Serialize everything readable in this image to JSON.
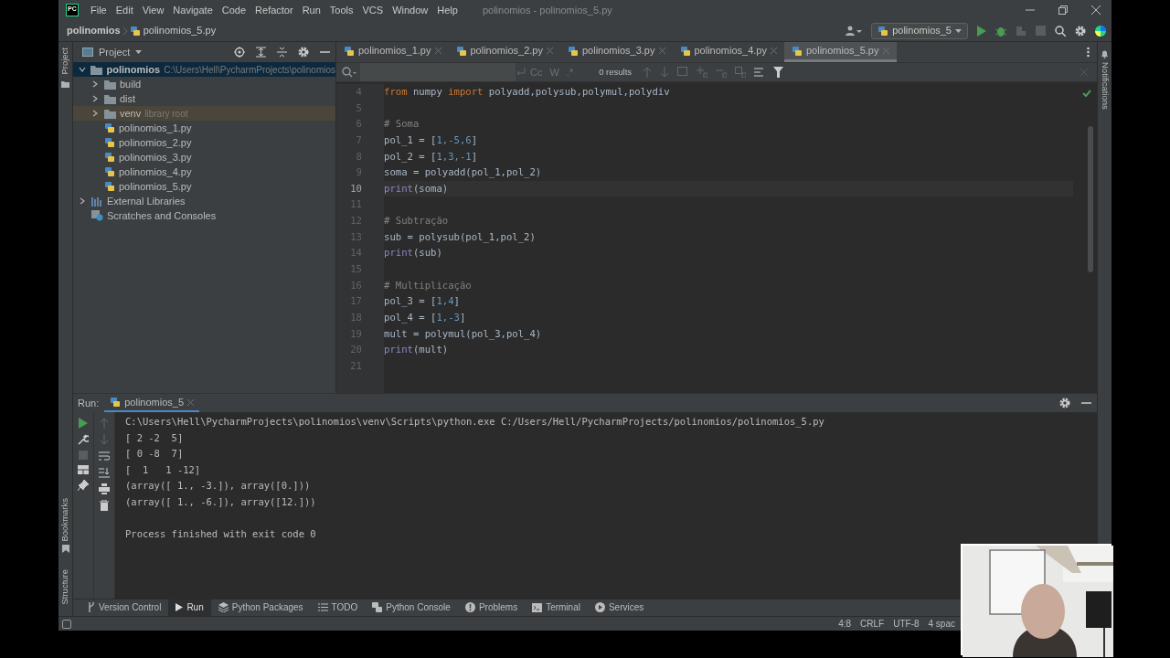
{
  "window": {
    "logo": "PC",
    "menu": [
      "File",
      "Edit",
      "View",
      "Navigate",
      "Code",
      "Refactor",
      "Run",
      "Tools",
      "VCS",
      "Window",
      "Help"
    ],
    "title": "polinomios - polinomios_5.py"
  },
  "breadcrumb": [
    "polinomios",
    "polinomios_5.py"
  ],
  "run_config": "polinomios_5",
  "side_tabs": {
    "left_top": "Project",
    "left_bottom": [
      "Bookmarks",
      "Structure"
    ],
    "right": "Notifications"
  },
  "project_panel": {
    "title": "Project",
    "tree": [
      {
        "label": "polinomios",
        "hint": "C:\\Users\\Hell\\PycharmProjects\\polinomios",
        "kind": "folder",
        "expanded": true,
        "selected": true,
        "hovered": false,
        "children": [
          {
            "label": "build",
            "kind": "folder",
            "expanded": false,
            "selected": false,
            "hovered": false
          },
          {
            "label": "dist",
            "kind": "folder",
            "expanded": false,
            "selected": false,
            "hovered": false
          },
          {
            "label": "venv",
            "hint": "library root",
            "kind": "folder",
            "expanded": false,
            "selected": false,
            "hovered": true
          },
          {
            "label": "polinomios_1.py",
            "kind": "file",
            "selected": false,
            "hovered": false
          },
          {
            "label": "polinomios_2.py",
            "kind": "file",
            "selected": false,
            "hovered": false
          },
          {
            "label": "polinomios_3.py",
            "kind": "file",
            "selected": false,
            "hovered": false
          },
          {
            "label": "polinomios_4.py",
            "kind": "file",
            "selected": false,
            "hovered": false
          },
          {
            "label": "polinomios_5.py",
            "kind": "file",
            "selected": false,
            "hovered": false
          }
        ]
      },
      {
        "label": "External Libraries",
        "kind": "libraries",
        "expanded": false,
        "selected": false,
        "hovered": false
      },
      {
        "label": "Scratches and Consoles",
        "kind": "scratches",
        "selected": false,
        "hovered": false
      }
    ]
  },
  "tabs": [
    {
      "label": "polinomios_1.py",
      "selected": false
    },
    {
      "label": "polinomios_2.py",
      "selected": false
    },
    {
      "label": "polinomios_3.py",
      "selected": false
    },
    {
      "label": "polinomios_4.py",
      "selected": false
    },
    {
      "label": "polinomios_5.py",
      "selected": true
    }
  ],
  "find_bar": {
    "options": [
      "Cc",
      "W",
      ".*"
    ],
    "results": "0 results"
  },
  "editor": {
    "lines": [
      {
        "number": "4",
        "current": false,
        "tokens": [
          {
            "text": "from",
            "kind": "keyword"
          },
          {
            "text": " numpy ",
            "kind": "plain"
          },
          {
            "text": "import",
            "kind": "keyword"
          },
          {
            "text": " polyadd,polysub,polymul,polydiv",
            "kind": "plain"
          }
        ]
      },
      {
        "number": "5",
        "current": false
      },
      {
        "number": "6",
        "current": false,
        "tokens": [
          {
            "text": "# Soma",
            "kind": "comment"
          }
        ]
      },
      {
        "number": "7",
        "current": false,
        "tokens": [
          {
            "text": "pol_1 = [",
            "kind": "plain"
          },
          {
            "text": "1,-5,6",
            "kind": "number"
          },
          {
            "text": "]",
            "kind": "plain"
          }
        ]
      },
      {
        "number": "8",
        "current": false,
        "tokens": [
          {
            "text": "pol_2 = [",
            "kind": "plain"
          },
          {
            "text": "1,3,-1",
            "kind": "number"
          },
          {
            "text": "]",
            "kind": "plain"
          }
        ]
      },
      {
        "number": "9",
        "current": false,
        "tokens": [
          {
            "text": "soma = polyadd(pol_1,pol_2)",
            "kind": "plain"
          }
        ]
      },
      {
        "number": "10",
        "current": true,
        "tokens": [
          {
            "text": "print",
            "kind": "builtin"
          },
          {
            "text": "(soma)",
            "kind": "plain"
          }
        ]
      },
      {
        "number": "11",
        "current": false
      },
      {
        "number": "12",
        "current": false,
        "tokens": [
          {
            "text": "# Subtração",
            "kind": "comment"
          }
        ]
      },
      {
        "number": "13",
        "current": false,
        "tokens": [
          {
            "text": "sub = polysub(pol_1,pol_2)",
            "kind": "plain"
          }
        ]
      },
      {
        "number": "14",
        "current": false,
        "tokens": [
          {
            "text": "print",
            "kind": "builtin"
          },
          {
            "text": "(sub)",
            "kind": "plain"
          }
        ]
      },
      {
        "number": "15",
        "current": false
      },
      {
        "number": "16",
        "current": false,
        "tokens": [
          {
            "text": "# Multiplicação",
            "kind": "comment"
          }
        ]
      },
      {
        "number": "17",
        "current": false,
        "tokens": [
          {
            "text": "pol_3 = [",
            "kind": "plain"
          },
          {
            "text": "1,4",
            "kind": "number"
          },
          {
            "text": "]",
            "kind": "plain"
          }
        ]
      },
      {
        "number": "18",
        "current": false,
        "tokens": [
          {
            "text": "pol_4 = [",
            "kind": "plain"
          },
          {
            "text": "1,-3",
            "kind": "number"
          },
          {
            "text": "]",
            "kind": "plain"
          }
        ]
      },
      {
        "number": "19",
        "current": false,
        "tokens": [
          {
            "text": "mult = polymul(pol_3,pol_4)",
            "kind": "plain"
          }
        ]
      },
      {
        "number": "20",
        "current": false,
        "tokens": [
          {
            "text": "print",
            "kind": "builtin"
          },
          {
            "text": "(mult)",
            "kind": "plain"
          }
        ]
      },
      {
        "number": "21",
        "current": false
      }
    ]
  },
  "run_panel": {
    "label": "Run:",
    "tab": "polinomios_5",
    "output": [
      "C:\\Users\\Hell\\PycharmProjects\\polinomios\\venv\\Scripts\\python.exe C:/Users/Hell/PycharmProjects/polinomios/polinomios_5.py",
      "[ 2 -2  5]",
      "[ 0 -8  7]",
      "[  1   1 -12]",
      "(array([ 1., -3.]), array([0.]))",
      "(array([ 1., -6.]), array([12.]))"
    ],
    "exit_message": "Process finished with exit code 0"
  },
  "tool_windows": [
    {
      "label": "Version Control",
      "selected": false
    },
    {
      "label": "Run",
      "selected": true
    },
    {
      "label": "Python Packages",
      "selected": false
    },
    {
      "label": "TODO",
      "selected": false
    },
    {
      "label": "Python Console",
      "selected": false
    },
    {
      "label": "Problems",
      "selected": false
    },
    {
      "label": "Terminal",
      "selected": false
    },
    {
      "label": "Services",
      "selected": false
    }
  ],
  "status_bar": [
    "4:8",
    "CRLF",
    "UTF-8",
    "4 spac"
  ]
}
